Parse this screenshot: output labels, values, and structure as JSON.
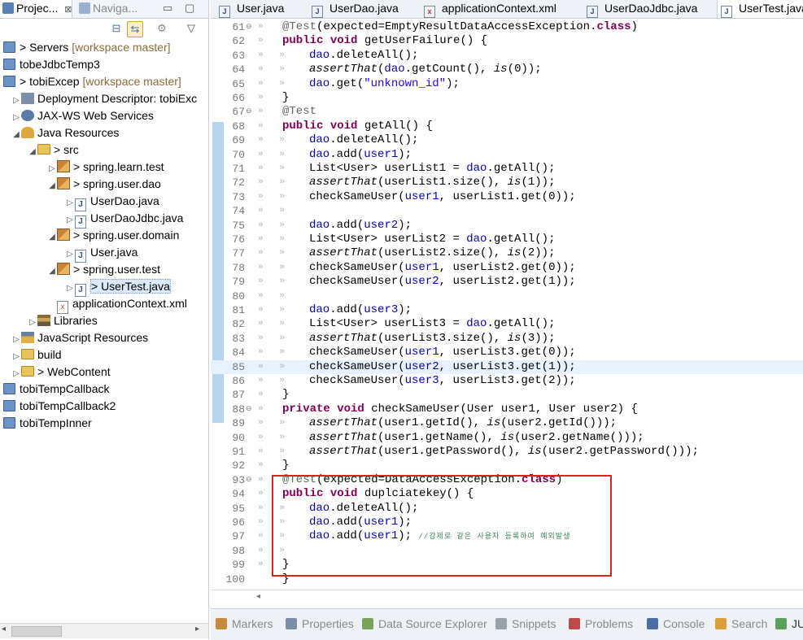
{
  "left_tabs": {
    "project_explorer": "Projec...",
    "navigator": "Naviga...",
    "close_glyph": "⊠"
  },
  "tree": [
    {
      "id": "servers",
      "depth": 0,
      "arrow": "",
      "icon": "project",
      "label": "> Servers",
      "suffix": "[workspace master]"
    },
    {
      "id": "tobeJdbcTemp3",
      "depth": 0,
      "arrow": "",
      "icon": "project",
      "label": "tobeJdbcTemp3",
      "suffix": ""
    },
    {
      "id": "tobiExcep",
      "depth": 0,
      "arrow": "",
      "icon": "project",
      "label": "> tobiExcep",
      "suffix": "[workspace master]"
    },
    {
      "id": "deployment-descriptor",
      "depth": 1,
      "arrow": "▷",
      "icon": "descriptor",
      "label": "Deployment Descriptor: tobiExc",
      "suffix": ""
    },
    {
      "id": "jaxws",
      "depth": 1,
      "arrow": "▷",
      "icon": "jaxws",
      "label": "JAX-WS Web Services",
      "suffix": ""
    },
    {
      "id": "java-resources",
      "depth": 1,
      "arrow": "◢",
      "icon": "javares",
      "label": "Java Resources",
      "suffix": ""
    },
    {
      "id": "src",
      "depth": 2,
      "arrow": "◢",
      "icon": "srcfolder",
      "label": "> src",
      "suffix": ""
    },
    {
      "id": "spring-learn-test",
      "depth": 3,
      "arrow": "▷",
      "icon": "package",
      "label": "> spring.learn.test",
      "suffix": ""
    },
    {
      "id": "spring-user-dao",
      "depth": 3,
      "arrow": "◢",
      "icon": "package",
      "label": "> spring.user.dao",
      "suffix": ""
    },
    {
      "id": "UserDao-java",
      "depth": 4,
      "arrow": "▷",
      "icon": "java",
      "label": "UserDao.java",
      "suffix": ""
    },
    {
      "id": "UserDaoJdbc-java",
      "depth": 4,
      "arrow": "▷",
      "icon": "java",
      "label": "UserDaoJdbc.java",
      "suffix": ""
    },
    {
      "id": "spring-user-domain",
      "depth": 3,
      "arrow": "◢",
      "icon": "package",
      "label": "> spring.user.domain",
      "suffix": ""
    },
    {
      "id": "User-java",
      "depth": 4,
      "arrow": "▷",
      "icon": "java",
      "label": "User.java",
      "suffix": ""
    },
    {
      "id": "spring-user-test",
      "depth": 3,
      "arrow": "◢",
      "icon": "package",
      "label": "> spring.user.test",
      "suffix": ""
    },
    {
      "id": "UserTest-java",
      "depth": 4,
      "arrow": "▷",
      "icon": "java",
      "label": "> UserTest.java",
      "suffix": "",
      "selected": true
    },
    {
      "id": "applicationContext-xml",
      "depth": 3,
      "arrow": "",
      "icon": "xml",
      "label": "applicationContext.xml",
      "suffix": ""
    },
    {
      "id": "libraries",
      "depth": 2,
      "arrow": "▷",
      "icon": "library",
      "label": "Libraries",
      "suffix": ""
    },
    {
      "id": "javascript-resources",
      "depth": 1,
      "arrow": "▷",
      "icon": "jsres",
      "label": "JavaScript Resources",
      "suffix": ""
    },
    {
      "id": "build",
      "depth": 1,
      "arrow": "▷",
      "icon": "folder",
      "label": "build",
      "suffix": ""
    },
    {
      "id": "WebContent",
      "depth": 1,
      "arrow": "▷",
      "icon": "folder",
      "label": "> WebContent",
      "suffix": ""
    },
    {
      "id": "tobiTempCallback",
      "depth": 0,
      "arrow": "",
      "icon": "project",
      "label": "tobiTempCallback",
      "suffix": ""
    },
    {
      "id": "tobiTempCallback2",
      "depth": 0,
      "arrow": "",
      "icon": "project",
      "label": "tobiTempCallback2",
      "suffix": ""
    },
    {
      "id": "tobiTempInner",
      "depth": 0,
      "arrow": "",
      "icon": "project",
      "label": "tobiTempInner",
      "suffix": ""
    }
  ],
  "editor_tabs": [
    {
      "label": "User.java",
      "icon": "J"
    },
    {
      "label": "UserDao.java",
      "icon": "J"
    },
    {
      "label": "applicationContext.xml",
      "icon": "x"
    },
    {
      "label": "UserDaoJdbc.java",
      "icon": "J"
    },
    {
      "label": "UserTest.java",
      "icon": "J",
      "active": true
    }
  ],
  "code_lines": [
    {
      "n": "61",
      "fold": "⊖",
      "ind": 1,
      "html": "<span class='ann'>@Test</span>(expected=EmptyResultDataAccessException.<span class='kw'>class</span>)"
    },
    {
      "n": "62",
      "fold": "",
      "ind": 1,
      "html": "<span class='kw'>public</span> <span class='kw'>void</span> getUserFailure() {"
    },
    {
      "n": "63",
      "fold": "",
      "ind": 2,
      "html": "<span class='fld'>dao</span>.deleteAll();"
    },
    {
      "n": "64",
      "fold": "",
      "ind": 2,
      "html": "<span class='ital'>assertThat</span>(<span class='fld'>dao</span>.getCount(), <span class='ital'>is</span>(0));"
    },
    {
      "n": "65",
      "fold": "",
      "ind": 2,
      "html": "<span class='fld'>dao</span>.get(<span class='str'>\"unknown_id\"</span>);"
    },
    {
      "n": "66",
      "fold": "",
      "ind": 1,
      "html": "}"
    },
    {
      "n": "67",
      "fold": "⊖",
      "ind": 1,
      "html": "<span class='ann'>@Test</span>"
    },
    {
      "n": "68",
      "fold": "",
      "ind": 1,
      "html": "<span class='kw'>public</span> <span class='kw'>void</span> getAll() {"
    },
    {
      "n": "69",
      "fold": "",
      "ind": 2,
      "html": "<span class='fld'>dao</span>.deleteAll();"
    },
    {
      "n": "70",
      "fold": "",
      "ind": 2,
      "html": "<span class='fld'>dao</span>.add(<span class='fld'>user1</span>);"
    },
    {
      "n": "71",
      "fold": "",
      "ind": 2,
      "html": "List&lt;User&gt; userList1 = <span class='fld'>dao</span>.getAll();"
    },
    {
      "n": "72",
      "fold": "",
      "ind": 2,
      "html": "<span class='ital'>assertThat</span>(userList1.size(), <span class='ital'>is</span>(1));"
    },
    {
      "n": "73",
      "fold": "",
      "ind": 2,
      "html": "checkSameUser(<span class='fld'>user1</span>, userList1.get(0));"
    },
    {
      "n": "74",
      "fold": "",
      "ind": 2,
      "html": ""
    },
    {
      "n": "75",
      "fold": "",
      "ind": 2,
      "html": "<span class='fld'>dao</span>.add(<span class='fld'>user2</span>);"
    },
    {
      "n": "76",
      "fold": "",
      "ind": 2,
      "html": "List&lt;User&gt; userList2 = <span class='fld'>dao</span>.getAll();"
    },
    {
      "n": "77",
      "fold": "",
      "ind": 2,
      "html": "<span class='ital'>assertThat</span>(userList2.size(), <span class='ital'>is</span>(2));"
    },
    {
      "n": "78",
      "fold": "",
      "ind": 2,
      "html": "checkSameUser(<span class='fld'>user1</span>, userList2.get(0));"
    },
    {
      "n": "79",
      "fold": "",
      "ind": 2,
      "html": "checkSameUser(<span class='fld'>user2</span>, userList2.get(1));"
    },
    {
      "n": "80",
      "fold": "",
      "ind": 2,
      "html": ""
    },
    {
      "n": "81",
      "fold": "",
      "ind": 2,
      "html": "<span class='fld'>dao</span>.add(<span class='fld'>user3</span>);"
    },
    {
      "n": "82",
      "fold": "",
      "ind": 2,
      "html": "List&lt;User&gt; userList3 = <span class='fld'>dao</span>.getAll();"
    },
    {
      "n": "83",
      "fold": "",
      "ind": 2,
      "html": "<span class='ital'>assertThat</span>(userList3.size(), <span class='ital'>is</span>(3));"
    },
    {
      "n": "84",
      "fold": "",
      "ind": 2,
      "html": "checkSameUser(<span class='fld'>user1</span>, userList3.get(0));"
    },
    {
      "n": "85",
      "fold": "",
      "ind": 2,
      "html": "checkSameUser(<span class='fld'>user2</span>, userList3.get(1));",
      "current": true
    },
    {
      "n": "86",
      "fold": "",
      "ind": 2,
      "html": "checkSameUser(<span class='fld'>user3</span>, userList3.get(2));"
    },
    {
      "n": "87",
      "fold": "",
      "ind": 1,
      "html": "}"
    },
    {
      "n": "88",
      "fold": "⊖",
      "ind": 1,
      "html": "<span class='kw'>private</span> <span class='kw'>void</span> checkSameUser(User user1, User user2) {"
    },
    {
      "n": "89",
      "fold": "",
      "ind": 2,
      "html": "<span class='ital'>assertThat</span>(user1.getId(), <span class='ital'>is</span>(user2.getId()));"
    },
    {
      "n": "90",
      "fold": "",
      "ind": 2,
      "html": "<span class='ital'>assertThat</span>(user1.getName(), <span class='ital'>is</span>(user2.getName()));"
    },
    {
      "n": "91",
      "fold": "",
      "ind": 2,
      "html": "<span class='ital'>assertThat</span>(user1.getPassword(), <span class='ital'>is</span>(user2.getPassword()));"
    },
    {
      "n": "92",
      "fold": "",
      "ind": 1,
      "html": "}"
    },
    {
      "n": "93",
      "fold": "⊖",
      "ind": 1,
      "html": "<span class='ann'>@Test</span>(expected=DataAccessException.<span class='kw'>class</span>)"
    },
    {
      "n": "94",
      "fold": "",
      "ind": 1,
      "html": "<span class='kw'>public</span> <span class='kw'>void</span> duplciatekey() {"
    },
    {
      "n": "95",
      "fold": "",
      "ind": 2,
      "html": "<span class='fld'>dao</span>.deleteAll();"
    },
    {
      "n": "96",
      "fold": "",
      "ind": 2,
      "html": "<span class='fld'>dao</span>.add(<span class='fld'>user1</span>);"
    },
    {
      "n": "97",
      "fold": "",
      "ind": 2,
      "html": "<span class='fld'>dao</span>.add(<span class='fld'>user1</span>); <span class='cmt'>//강제로 같은 사용자 등록하여 예외발생</span>"
    },
    {
      "n": "98",
      "fold": "",
      "ind": 2,
      "html": ""
    },
    {
      "n": "99",
      "fold": "",
      "ind": 1,
      "html": "}"
    },
    {
      "n": "100",
      "fold": "",
      "ind": 0,
      "html": "}"
    }
  ],
  "bottom_tabs": [
    {
      "label": "Markers",
      "color": "#c98a3a"
    },
    {
      "label": "Properties",
      "color": "#7b8fa8"
    },
    {
      "label": "Data Source Explorer",
      "color": "#7aa35a"
    },
    {
      "label": "Snippets",
      "color": "#9aa0a8"
    },
    {
      "label": "Problems",
      "color": "#c04a4a"
    },
    {
      "label": "Console",
      "color": "#4a6fa5"
    },
    {
      "label": "Search",
      "color": "#d9a03a"
    },
    {
      "label": "JU",
      "color": "#5aa05a"
    }
  ],
  "colors": {
    "keyword": "#7f0055",
    "annotation": "#646464",
    "string": "#2a00ff",
    "field": "#0000c0",
    "comment": "#3f7f5f",
    "highlight_box": "#e02020"
  }
}
